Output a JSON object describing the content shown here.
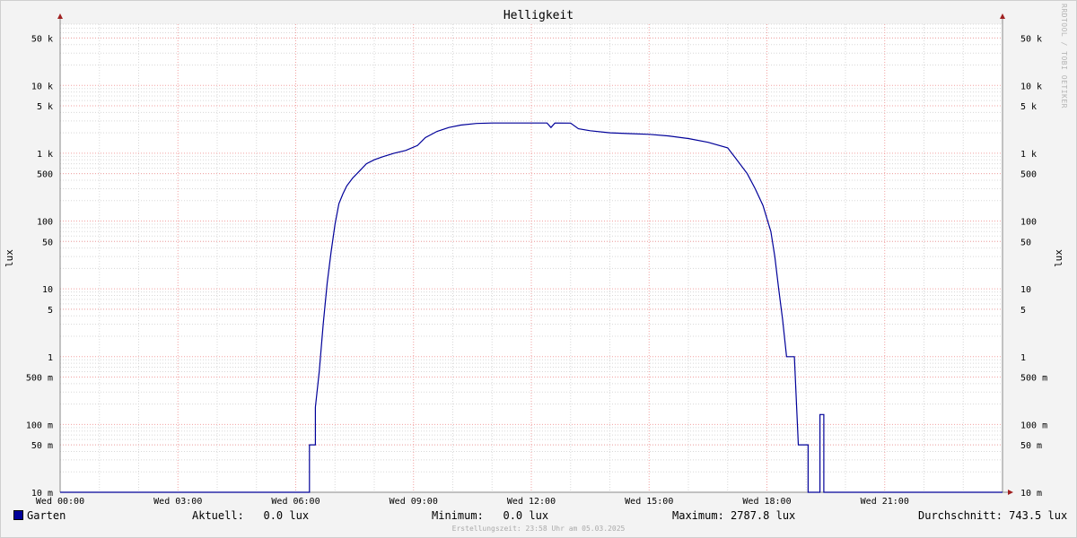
{
  "chart_data": {
    "type": "line",
    "title": "Helligkeit",
    "ylabel": "lux",
    "y_scale": "log",
    "ylim": [
      0.01,
      80000
    ],
    "x_ticks": [
      "Wed 00:00",
      "Wed 03:00",
      "Wed 06:00",
      "Wed 09:00",
      "Wed 12:00",
      "Wed 15:00",
      "Wed 18:00",
      "Wed 21:00"
    ],
    "y_ticks": [
      {
        "value": 50000,
        "label": "50 k"
      },
      {
        "value": 10000,
        "label": "10 k"
      },
      {
        "value": 5000,
        "label": "5 k"
      },
      {
        "value": 1000,
        "label": "1 k"
      },
      {
        "value": 500,
        "label": "500"
      },
      {
        "value": 100,
        "label": "100"
      },
      {
        "value": 50,
        "label": "50"
      },
      {
        "value": 10,
        "label": "10"
      },
      {
        "value": 5,
        "label": "5"
      },
      {
        "value": 1,
        "label": "1"
      },
      {
        "value": 0.5,
        "label": "500 m"
      },
      {
        "value": 0.1,
        "label": "100 m"
      },
      {
        "value": 0.05,
        "label": "50 m"
      },
      {
        "value": 0.01,
        "label": "10 m"
      }
    ],
    "grid": true,
    "colors": {
      "series": "#000099",
      "major_grid": "#f2a0a0",
      "minor_grid": "#d8d8d8",
      "axis": "#a02020"
    },
    "series": [
      {
        "name": "Garten",
        "x_hours": [
          0,
          6.35,
          6.35,
          6.5,
          6.5,
          6.6,
          6.7,
          6.8,
          6.9,
          7.0,
          7.1,
          7.2,
          7.3,
          7.45,
          7.6,
          7.8,
          8.0,
          8.2,
          8.5,
          8.8,
          9.1,
          9.3,
          9.6,
          9.9,
          10.2,
          10.6,
          11.0,
          11.5,
          12.0,
          12.4,
          12.5,
          12.6,
          13.0,
          13.2,
          13.5,
          14.0,
          14.5,
          15.0,
          15.5,
          16.0,
          16.5,
          17.0,
          17.2,
          17.5,
          17.7,
          17.9,
          18.1,
          18.2,
          18.3,
          18.4,
          18.5,
          18.6,
          18.7,
          18.8,
          18.9,
          19.05,
          19.05,
          19.1,
          19.35,
          19.35,
          19.45,
          19.45,
          19.6,
          19.6,
          24
        ],
        "values": [
          0.01,
          0.01,
          0.05,
          0.05,
          0.18,
          0.6,
          3,
          12,
          35,
          90,
          180,
          250,
          330,
          430,
          530,
          700,
          800,
          880,
          1000,
          1100,
          1300,
          1700,
          2100,
          2400,
          2600,
          2750,
          2787.8,
          2787.8,
          2787.8,
          2787.8,
          2400,
          2787.8,
          2780,
          2300,
          2150,
          2000,
          1950,
          1900,
          1800,
          1650,
          1450,
          1200,
          850,
          500,
          300,
          170,
          70,
          30,
          10,
          3.5,
          1,
          1,
          1,
          0.05,
          0.05,
          0.05,
          0.01,
          0.01,
          0.01,
          0.14,
          0.14,
          0.01,
          0.01,
          0.01,
          0.01
        ]
      }
    ]
  },
  "legend": {
    "series_name": "Garten",
    "aktuell": "Aktuell:   0.0 lux",
    "minimum": "Minimum:   0.0 lux",
    "maximum": "Maximum: 2787.8 lux",
    "durchschnitt": "Durchschnitt: 743.5 lux"
  },
  "watermark": "RRDTOOL / TOBI OETIKER",
  "footer": "Erstellungszeit: 23:58 Uhr am 05.03.2025"
}
